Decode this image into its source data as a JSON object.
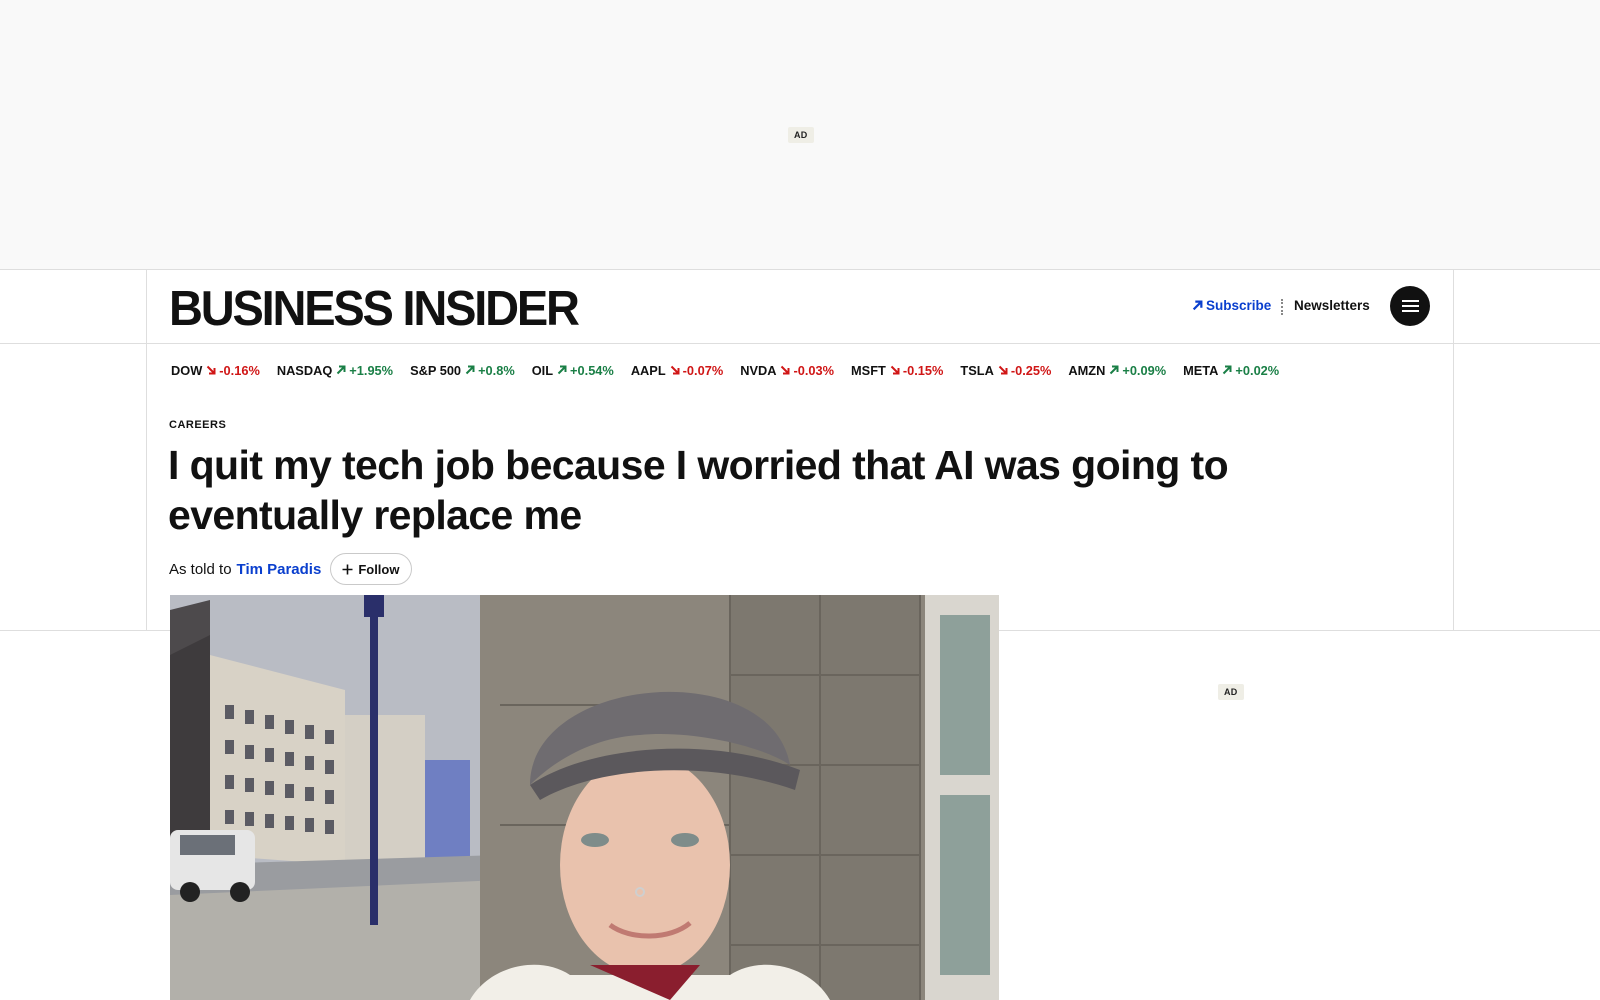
{
  "ads": {
    "top_label": "AD",
    "side_label": "AD"
  },
  "header": {
    "logo": "BUSINESS INSIDER",
    "subscribe_label": "Subscribe",
    "newsletters_label": "Newsletters"
  },
  "ticker": [
    {
      "symbol": "DOW",
      "change": "-0.16%",
      "direction": "down"
    },
    {
      "symbol": "NASDAQ",
      "change": "+1.95%",
      "direction": "up"
    },
    {
      "symbol": "S&P 500",
      "change": "+0.8%",
      "direction": "up"
    },
    {
      "symbol": "OIL",
      "change": "+0.54%",
      "direction": "up"
    },
    {
      "symbol": "AAPL",
      "change": "-0.07%",
      "direction": "down"
    },
    {
      "symbol": "NVDA",
      "change": "-0.03%",
      "direction": "down"
    },
    {
      "symbol": "MSFT",
      "change": "-0.15%",
      "direction": "down"
    },
    {
      "symbol": "TSLA",
      "change": "-0.25%",
      "direction": "down"
    },
    {
      "symbol": "AMZN",
      "change": "+0.09%",
      "direction": "up"
    },
    {
      "symbol": "META",
      "change": "+0.02%",
      "direction": "up"
    }
  ],
  "article": {
    "category": "CAREERS",
    "headline": "I quit my tech job because I worried that AI was going to eventually replace me",
    "byline_prefix": "As told to",
    "author": "Tim Paradis",
    "follow_label": "Follow"
  },
  "colors": {
    "accent": "#0a3fce",
    "up": "#1a7f46",
    "down": "#d01616"
  },
  "icons": {
    "subscribe": "arrow-up-right-icon",
    "menu": "hamburger-icon",
    "follow": "plus-icon"
  }
}
